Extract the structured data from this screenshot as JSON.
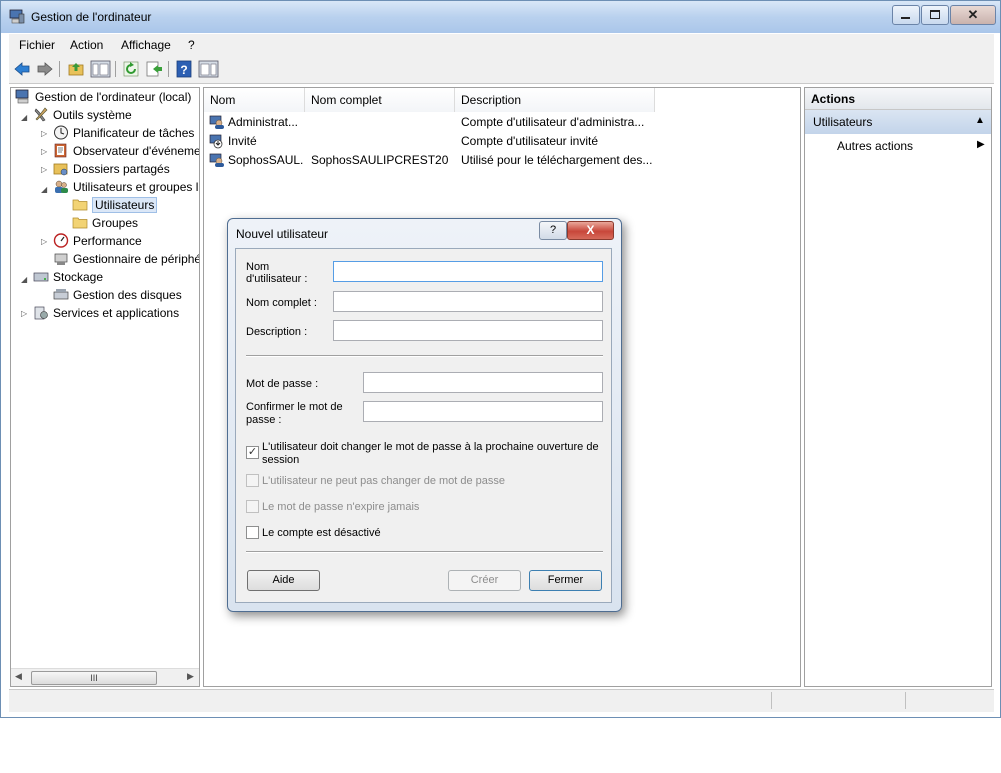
{
  "window": {
    "title": "Gestion de l'ordinateur"
  },
  "menu": [
    "Fichier",
    "Action",
    "Affichage",
    "?"
  ],
  "tree": {
    "root": "Gestion de l'ordinateur (local)",
    "system_tools": "Outils système",
    "task_scheduler": "Planificateur de tâches",
    "event_viewer": "Observateur d'événeme",
    "shared_folders": "Dossiers partagés",
    "local_users": "Utilisateurs et groupes l",
    "users": "Utilisateurs",
    "groups": "Groupes",
    "performance": "Performance",
    "device_manager": "Gestionnaire de périphé",
    "storage": "Stockage",
    "disk_management": "Gestion des disques",
    "services": "Services et applications",
    "scroll_thumb": "III"
  },
  "list": {
    "headers": [
      "Nom",
      "Nom complet",
      "Description"
    ],
    "rows": [
      {
        "name": "Administrat...",
        "full": "",
        "desc": "Compte d'utilisateur d'administra..."
      },
      {
        "name": "Invité",
        "full": "",
        "desc": "Compte d'utilisateur invité"
      },
      {
        "name": "SophosSAUL...",
        "full": "SophosSAULIPCREST20",
        "desc": "Utilisé pour le téléchargement des..."
      }
    ]
  },
  "actions": {
    "title": "Actions",
    "section": "Utilisateurs",
    "more": "Autres actions"
  },
  "dialog": {
    "title": "Nouvel utilisateur",
    "help_btn": "?",
    "close_btn": "X",
    "username_label_1": "Nom",
    "username_label_2": "d'utilisateur :",
    "fullname_label": "Nom complet :",
    "description_label": "Description :",
    "password_label": "Mot de passe :",
    "confirm_label_1": "Confirmer le mot de",
    "confirm_label_2": "passe :",
    "chk1_line1": "L'utilisateur doit changer le mot de passe à la prochaine ouverture de",
    "chk1_line2": "session",
    "chk2": "L'utilisateur ne peut pas changer de mot de passe",
    "chk3": "Le mot de passe n'expire jamais",
    "chk4": "Le compte est désactivé",
    "btn_help": "Aide",
    "btn_create": "Créer",
    "btn_close": "Fermer",
    "username_value": "",
    "fullname_value": "",
    "description_value": "",
    "password_value": "",
    "confirm_value": "",
    "chk1_checked": true,
    "chk2_checked": false,
    "chk3_checked": false,
    "chk4_checked": false
  }
}
